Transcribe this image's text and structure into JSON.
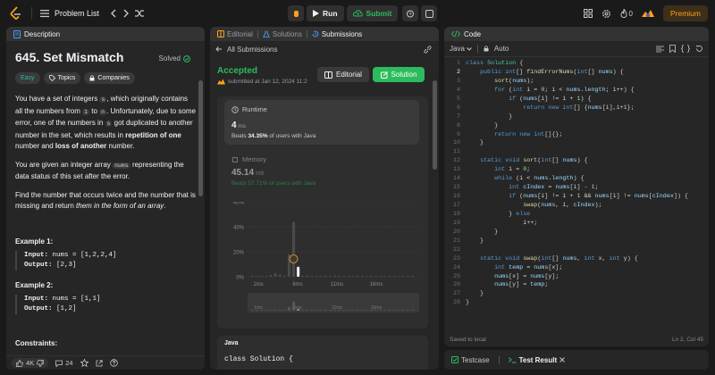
{
  "topbar": {
    "title": "Problem List",
    "run_label": "Run",
    "submit_label": "Submit",
    "streak": "0",
    "premium_label": "Premium",
    "colors": {
      "submit": "#2cbb5d",
      "premium": "#ffa116"
    }
  },
  "description": {
    "tab_label": "Description",
    "title": "645. Set Mismatch",
    "solved_label": "Solved",
    "chips": [
      "Easy",
      "Topics",
      "Companies"
    ],
    "p1": {
      "a": "You have a set of integers ",
      "c1": "s",
      "b": ", which originally contains all the numbers from ",
      "c2": "1",
      "c": " to ",
      "c3": "n",
      "d": ". Unfortunately, due to some error, one of the numbers in ",
      "c4": "s",
      "e": " got duplicated to another number in the set, which results in ",
      "b1": "repetition of one",
      "f": " number and ",
      "b2": "loss of another",
      "g": " number."
    },
    "p2": {
      "a": "You are given an integer array ",
      "c1": "nums",
      "b": " representing the data status of this set after the error."
    },
    "p3": {
      "a": "Find the number that occurs twice and the number that is missing and return ",
      "i": "them in the form of an array",
      "b": "."
    },
    "example1": {
      "heading": "Example 1:",
      "input_label": "Input:",
      "input": " nums = [1,2,2,4]",
      "output_label": "Output:",
      "output": " [2,3]"
    },
    "example2": {
      "heading": "Example 2:",
      "input_label": "Input:",
      "input": " nums = [1,1]",
      "output_label": "Output:",
      "output": " [1,2]"
    },
    "constraints": "Constraints:",
    "footer": {
      "likes": "4K",
      "comments": "24"
    }
  },
  "submissions": {
    "tabs": [
      "Editorial",
      "Solutions",
      "Submissions"
    ],
    "back_label": "All Submissions",
    "status": "Accepted",
    "submitted": "submitted at Jan 12, 2024 11:2",
    "editorial_btn": "Editorial",
    "solution_btn": "Solution",
    "runtime_label": "Runtime",
    "runtime_value": "4",
    "runtime_unit": " ms",
    "runtime_beats_pre": "Beats ",
    "runtime_beats_pct": "34.35%",
    "runtime_beats_post": " of users with Java",
    "memory_label": "Memory",
    "memory_value": "45.14",
    "memory_unit": " MB",
    "memory_beats": "Beats 57.71% of users with Java",
    "lang": "Java",
    "code_preview": "class Solution {"
  },
  "chart_data": {
    "type": "bar",
    "yticks": [
      "60%",
      "40%",
      "20%",
      "0%"
    ],
    "ylim": [
      0,
      60
    ],
    "xticks": [
      "1ms",
      "6ms",
      "11ms",
      "16ms"
    ],
    "values": [
      1,
      0.5,
      0.5,
      0.3,
      1.5,
      3,
      2,
      1,
      18,
      44,
      8,
      0.5,
      1,
      0.5,
      0.5,
      0.3,
      0.5,
      0.3,
      1,
      0.5,
      0.5,
      0.3,
      0.5,
      0.3,
      0.3,
      0.3,
      0.3,
      0.3,
      0.3,
      0.3,
      0.3,
      0.3,
      0.3,
      0.3,
      0.3,
      0.3
    ],
    "highlight_index": 10,
    "mini_xticks": [
      "1ms",
      "6ms",
      "11ms",
      "16ms"
    ]
  },
  "code": {
    "tab_label": "Code",
    "lang": "Java",
    "auto": "Auto",
    "lines": [
      "class Solution {",
      "    public int[] findErrorNums(int[] nums) {",
      "        sort(nums);",
      "        for (int i = 0; i < nums.length; i++) {",
      "            if (nums[i] != i + 1) {",
      "                return new int[] {nums[i],i+1};",
      "            }",
      "        }",
      "        return new int[]{};",
      "    }",
      "",
      "    static void sort(int[] nums) {",
      "        int i = 0;",
      "        while (i < nums.length) {",
      "            int cIndex = nums[i] - 1;",
      "            if (nums[i] != i + 1 && nums[i] != nums[cIndex]) {",
      "                swap(nums, i, cIndex);",
      "            } else",
      "                i++;",
      "        }",
      "    }",
      "",
      "    static void swap(int[] nums, int x, int y) {",
      "        int temp = nums[x];",
      "        nums[x] = nums[y];",
      "        nums[y] = temp;",
      "    }",
      "}"
    ],
    "saved": "Saved to local",
    "position": "Ln 2, Col 45"
  },
  "testbar": {
    "testcase": "Testcase",
    "result": "Test Result"
  }
}
